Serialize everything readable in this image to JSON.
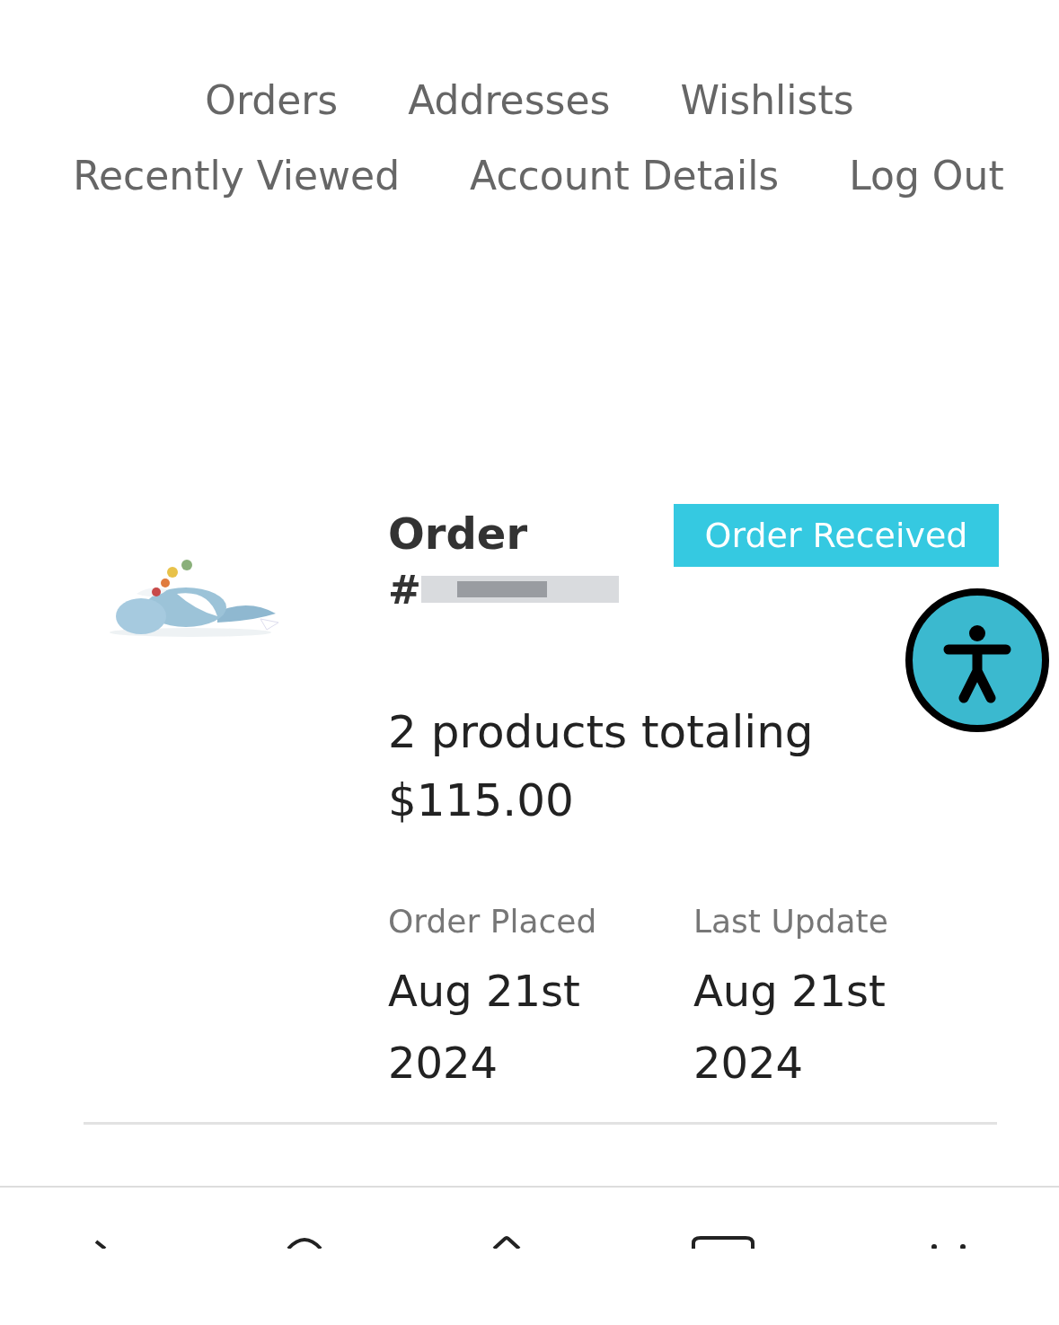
{
  "nav": [
    {
      "label": "Orders"
    },
    {
      "label": "Addresses"
    },
    {
      "label": "Wishlists"
    },
    {
      "label": "Recently Viewed"
    },
    {
      "label": "Account Details"
    },
    {
      "label": "Log Out"
    }
  ],
  "order": {
    "title": "Order",
    "number": "#",
    "status": "Order Received",
    "summary": "2 products totaling",
    "total": "$115.00",
    "dates": [
      {
        "label": "Order Placed",
        "value": "Aug 21st 2024"
      },
      {
        "label": "Last Update",
        "value": "Aug 21st 2024"
      }
    ]
  }
}
